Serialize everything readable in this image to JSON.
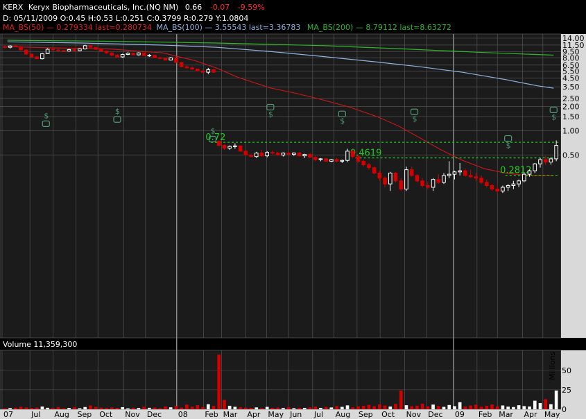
{
  "header": {
    "symbol": "KERX",
    "company": "Keryx Biopharmaceuticals, Inc.(NQ NM)",
    "last": "0.66",
    "change": "-0.07",
    "change_pct": "-9.59%",
    "ohlc_line": "D: 05/11/2009 O:0.45 H:0.53 L:0.251 C:0.3799 R:0.279 Y:1.0804",
    "ma50": "MA_BS(50) — 0.279334 last=0.280734",
    "ma100": "MA_BS(100) — 3.55543 last=3.36783",
    "ma200": "MA_BS(200) — 8.79112 last=8.63272"
  },
  "volume_label": "Volume 11,359,300",
  "volume_unit": "Millions",
  "colors": {
    "background": "#000000",
    "panel": "#1b1b1b",
    "grid": "#5c5c5c",
    "axis_bg": "#d9d9d9",
    "up": "#ffffff",
    "down": "#d40000",
    "ma50": "#c01818",
    "ma100": "#8fb3e0",
    "ma200": "#2eb82e",
    "level": "#22cc22",
    "news": "#4f9a7a"
  },
  "chart_data": {
    "type": "candlestick",
    "price_scale": "log",
    "y_ticks": [
      14.0,
      11.5,
      9.5,
      8.0,
      6.5,
      5.5,
      4.5,
      3.5,
      2.5,
      2.0,
      1.5,
      1.0,
      0.5
    ],
    "y_tick_labels": [
      "14.00",
      "11.50",
      "9.50",
      "8.00",
      "6.50",
      "5.50",
      "4.50",
      "3.50",
      "2.50",
      "2.00",
      "1.50",
      "1.00",
      "0.50"
    ],
    "x_labels": [
      "07",
      "Jul",
      "Aug",
      "Sep",
      "Oct",
      "Nov",
      "Dec",
      "08",
      "Feb",
      "Mar",
      "Apr",
      "May",
      "Jun",
      "Jul",
      "Aug",
      "Sep",
      "Oct",
      "Nov",
      "Dec",
      "09",
      "Feb",
      "Mar",
      "Apr",
      "May"
    ],
    "x_label_weeks": [
      0.0,
      5.2,
      9.5,
      13.8,
      17.9,
      22.7,
      26.8,
      32.6,
      37.6,
      41.0,
      45.5,
      49.4,
      53.5,
      58.0,
      62.0,
      66.3,
      70.6,
      75.2,
      79.3,
      84.3,
      88.7,
      92.5,
      97.2,
      101.0
    ],
    "year_divider_weeks": [
      32.6,
      84.3
    ],
    "total_weeks": 104,
    "levels": [
      {
        "label": "0.72",
        "value": 0.72
      },
      {
        "label": "0.4619",
        "value": 0.4619
      },
      {
        "label": "0.2812",
        "value": 0.2812
      }
    ],
    "news_events": [
      {
        "week": 8.2,
        "price": 1.55,
        "order": "dollar-first"
      },
      {
        "week": 21.5,
        "price": 1.75,
        "order": "dollar-first"
      },
      {
        "week": 39.3,
        "price": 1.0,
        "order": "dollar-first"
      },
      {
        "week": 50.1,
        "price": 2.0,
        "order": "icon-first"
      },
      {
        "week": 63.5,
        "price": 1.65,
        "order": "icon-first"
      },
      {
        "week": 77.0,
        "price": 1.75,
        "order": "icon-first"
      },
      {
        "week": 94.5,
        "price": 0.82,
        "order": "icon-first"
      },
      {
        "week": 103.0,
        "price": 1.85,
        "order": "icon-first"
      }
    ],
    "candles": [
      [
        11.0,
        11.3,
        10.5,
        10.8
      ],
      [
        10.8,
        11.5,
        10.4,
        11.2
      ],
      [
        11.2,
        11.8,
        10.9,
        11.0
      ],
      [
        11.0,
        11.1,
        9.8,
        10.0
      ],
      [
        10.0,
        10.2,
        8.7,
        8.9
      ],
      [
        8.9,
        9.0,
        8.0,
        8.2
      ],
      [
        8.2,
        8.4,
        7.7,
        7.8
      ],
      [
        7.8,
        9.2,
        7.6,
        9.0
      ],
      [
        9.0,
        10.5,
        8.9,
        10.2
      ],
      [
        10.2,
        10.8,
        9.8,
        10.0
      ],
      [
        10.0,
        10.3,
        9.6,
        9.8
      ],
      [
        9.8,
        10.0,
        9.5,
        9.7
      ],
      [
        9.7,
        10.4,
        9.5,
        10.1
      ],
      [
        10.1,
        10.4,
        9.6,
        9.8
      ],
      [
        9.8,
        10.5,
        9.6,
        10.3
      ],
      [
        10.3,
        11.6,
        10.1,
        11.3
      ],
      [
        11.3,
        11.6,
        10.5,
        10.8
      ],
      [
        10.8,
        10.9,
        10.0,
        10.2
      ],
      [
        10.2,
        10.4,
        9.5,
        9.7
      ],
      [
        9.7,
        9.8,
        8.9,
        9.2
      ],
      [
        9.2,
        9.4,
        8.4,
        8.6
      ],
      [
        8.6,
        8.8,
        8.0,
        8.2
      ],
      [
        8.2,
        9.0,
        8.0,
        8.8
      ],
      [
        8.8,
        9.4,
        8.6,
        9.1
      ],
      [
        9.1,
        9.3,
        8.6,
        8.7
      ],
      [
        8.7,
        9.4,
        8.5,
        9.2
      ],
      [
        9.2,
        9.3,
        8.4,
        8.5
      ],
      [
        8.5,
        8.9,
        8.2,
        8.6
      ],
      [
        8.6,
        8.7,
        7.9,
        8.0
      ],
      [
        8.0,
        8.3,
        7.7,
        7.9
      ],
      [
        7.9,
        8.0,
        7.4,
        7.5
      ],
      [
        7.5,
        8.2,
        7.4,
        8.0
      ],
      [
        8.0,
        8.1,
        6.9,
        7.0
      ],
      [
        7.0,
        7.1,
        6.1,
        6.2
      ],
      [
        6.2,
        6.4,
        5.9,
        6.0
      ],
      [
        6.0,
        6.3,
        5.7,
        5.8
      ],
      [
        5.8,
        5.9,
        5.4,
        5.5
      ],
      [
        5.5,
        5.6,
        5.2,
        5.3
      ],
      [
        5.3,
        6.0,
        5.0,
        5.7
      ],
      [
        5.7,
        5.8,
        5.2,
        5.3
      ],
      [
        0.74,
        0.76,
        0.64,
        0.66
      ],
      [
        0.66,
        0.68,
        0.58,
        0.61
      ],
      [
        0.61,
        0.66,
        0.58,
        0.64
      ],
      [
        0.64,
        0.7,
        0.6,
        0.65
      ],
      [
        0.65,
        0.66,
        0.55,
        0.56
      ],
      [
        0.56,
        0.58,
        0.49,
        0.5
      ],
      [
        0.5,
        0.52,
        0.47,
        0.48
      ],
      [
        0.48,
        0.55,
        0.46,
        0.53
      ],
      [
        0.53,
        0.58,
        0.48,
        0.49
      ],
      [
        0.49,
        0.56,
        0.47,
        0.54
      ],
      [
        0.54,
        0.57,
        0.51,
        0.53
      ],
      [
        0.53,
        0.55,
        0.49,
        0.5
      ],
      [
        0.5,
        0.54,
        0.48,
        0.53
      ],
      [
        0.53,
        0.55,
        0.5,
        0.51
      ],
      [
        0.51,
        0.54,
        0.49,
        0.53
      ],
      [
        0.53,
        0.55,
        0.48,
        0.49
      ],
      [
        0.49,
        0.52,
        0.46,
        0.51
      ],
      [
        0.51,
        0.53,
        0.46,
        0.47
      ],
      [
        0.47,
        0.49,
        0.42,
        0.44
      ],
      [
        0.44,
        0.46,
        0.42,
        0.45
      ],
      [
        0.45,
        0.46,
        0.41,
        0.42
      ],
      [
        0.42,
        0.45,
        0.41,
        0.44
      ],
      [
        0.44,
        0.46,
        0.41,
        0.42
      ],
      [
        0.42,
        0.44,
        0.4,
        0.43
      ],
      [
        0.43,
        0.6,
        0.41,
        0.56
      ],
      [
        0.56,
        0.58,
        0.46,
        0.48
      ],
      [
        0.48,
        0.5,
        0.4,
        0.42
      ],
      [
        0.42,
        0.44,
        0.36,
        0.38
      ],
      [
        0.38,
        0.4,
        0.33,
        0.35
      ],
      [
        0.35,
        0.36,
        0.29,
        0.3
      ],
      [
        0.3,
        0.32,
        0.24,
        0.26
      ],
      [
        0.26,
        0.27,
        0.2,
        0.22
      ],
      [
        0.22,
        0.31,
        0.18,
        0.3
      ],
      [
        0.3,
        0.31,
        0.23,
        0.24
      ],
      [
        0.24,
        0.26,
        0.18,
        0.19
      ],
      [
        0.19,
        0.36,
        0.18,
        0.33
      ],
      [
        0.33,
        0.36,
        0.27,
        0.28
      ],
      [
        0.28,
        0.29,
        0.23,
        0.24
      ],
      [
        0.24,
        0.26,
        0.2,
        0.21
      ],
      [
        0.21,
        0.23,
        0.19,
        0.2
      ],
      [
        0.2,
        0.26,
        0.18,
        0.25
      ],
      [
        0.25,
        0.29,
        0.22,
        0.23
      ],
      [
        0.23,
        0.3,
        0.22,
        0.28
      ],
      [
        0.28,
        0.42,
        0.26,
        0.29
      ],
      [
        0.29,
        0.32,
        0.25,
        0.31
      ],
      [
        0.31,
        0.4,
        0.28,
        0.32
      ],
      [
        0.32,
        0.34,
        0.27,
        0.28
      ],
      [
        0.28,
        0.33,
        0.26,
        0.27
      ],
      [
        0.27,
        0.3,
        0.24,
        0.26
      ],
      [
        0.26,
        0.28,
        0.22,
        0.23
      ],
      [
        0.23,
        0.25,
        0.2,
        0.21
      ],
      [
        0.21,
        0.22,
        0.18,
        0.19
      ],
      [
        0.19,
        0.21,
        0.17,
        0.18
      ],
      [
        0.18,
        0.21,
        0.17,
        0.2
      ],
      [
        0.2,
        0.22,
        0.18,
        0.21
      ],
      [
        0.21,
        0.24,
        0.19,
        0.22
      ],
      [
        0.22,
        0.25,
        0.2,
        0.24
      ],
      [
        0.24,
        0.3,
        0.23,
        0.29
      ],
      [
        0.29,
        0.33,
        0.27,
        0.32
      ],
      [
        0.32,
        0.4,
        0.3,
        0.39
      ],
      [
        0.39,
        0.46,
        0.35,
        0.44
      ],
      [
        0.44,
        0.49,
        0.38,
        0.41
      ],
      [
        0.41,
        0.47,
        0.38,
        0.45
      ],
      [
        0.45,
        0.76,
        0.42,
        0.66
      ]
    ],
    "volume": [
      1.2,
      1.5,
      2.0,
      3.1,
      2.4,
      1.8,
      2.2,
      3.5,
      1.9,
      1.6,
      2.8,
      1.4,
      1.7,
      2.6,
      1.3,
      2.9,
      4.8,
      3.0,
      2.1,
      1.5,
      2.4,
      1.8,
      2.7,
      1.2,
      2.0,
      1.6,
      3.3,
      1.9,
      2.2,
      1.4,
      3.6,
      2.5,
      4.1,
      2.2,
      6.0,
      3.4,
      5.2,
      2.8,
      6.5,
      4.3,
      70.0,
      12.0,
      4.5,
      3.2,
      2.6,
      2.1,
      1.8,
      2.4,
      1.5,
      3.1,
      1.9,
      2.2,
      1.6,
      2.8,
      1.4,
      2.0,
      1.7,
      2.5,
      3.4,
      1.8,
      2.9,
      2.3,
      4.0,
      3.1,
      5.0,
      2.6,
      3.8,
      4.4,
      5.6,
      3.9,
      6.2,
      4.8,
      3.5,
      6.8,
      24.0,
      5.2,
      3.9,
      4.5,
      7.2,
      3.6,
      6.0,
      4.2,
      3.1,
      5.5,
      4.0,
      9.0,
      3.6,
      4.8,
      5.9,
      3.2,
      4.5,
      6.1,
      3.8,
      4.9,
      3.4,
      2.9,
      5.2,
      4.1,
      3.6,
      11.0,
      8.0,
      13.0,
      6.5,
      24.0
    ],
    "volume_ticks": [
      50,
      25,
      0
    ],
    "volume_max": 72,
    "ma50": [
      [
        1,
        11.0
      ],
      [
        10,
        10.6
      ],
      [
        20,
        10.3
      ],
      [
        30,
        9.2
      ],
      [
        36,
        7.4
      ],
      [
        40,
        6.0
      ],
      [
        44,
        4.6
      ],
      [
        50,
        3.4
      ],
      [
        55,
        2.9
      ],
      [
        60,
        2.4
      ],
      [
        65,
        1.95
      ],
      [
        70,
        1.5
      ],
      [
        74,
        1.15
      ],
      [
        78,
        0.82
      ],
      [
        82,
        0.58
      ],
      [
        86,
        0.43
      ],
      [
        90,
        0.34
      ],
      [
        94,
        0.3
      ],
      [
        98,
        0.28
      ],
      [
        103,
        0.28
      ]
    ],
    "ma100": [
      [
        1,
        12.6
      ],
      [
        15,
        12.2
      ],
      [
        30,
        11.5
      ],
      [
        40,
        10.8
      ],
      [
        50,
        9.6
      ],
      [
        60,
        8.3
      ],
      [
        70,
        7.1
      ],
      [
        78,
        6.2
      ],
      [
        86,
        5.3
      ],
      [
        94,
        4.3
      ],
      [
        100,
        3.6
      ],
      [
        103,
        3.37
      ]
    ],
    "ma200": [
      [
        1,
        13.2
      ],
      [
        20,
        12.8
      ],
      [
        40,
        12.2
      ],
      [
        60,
        11.3
      ],
      [
        75,
        10.3
      ],
      [
        90,
        9.3
      ],
      [
        103,
        8.63
      ]
    ]
  }
}
